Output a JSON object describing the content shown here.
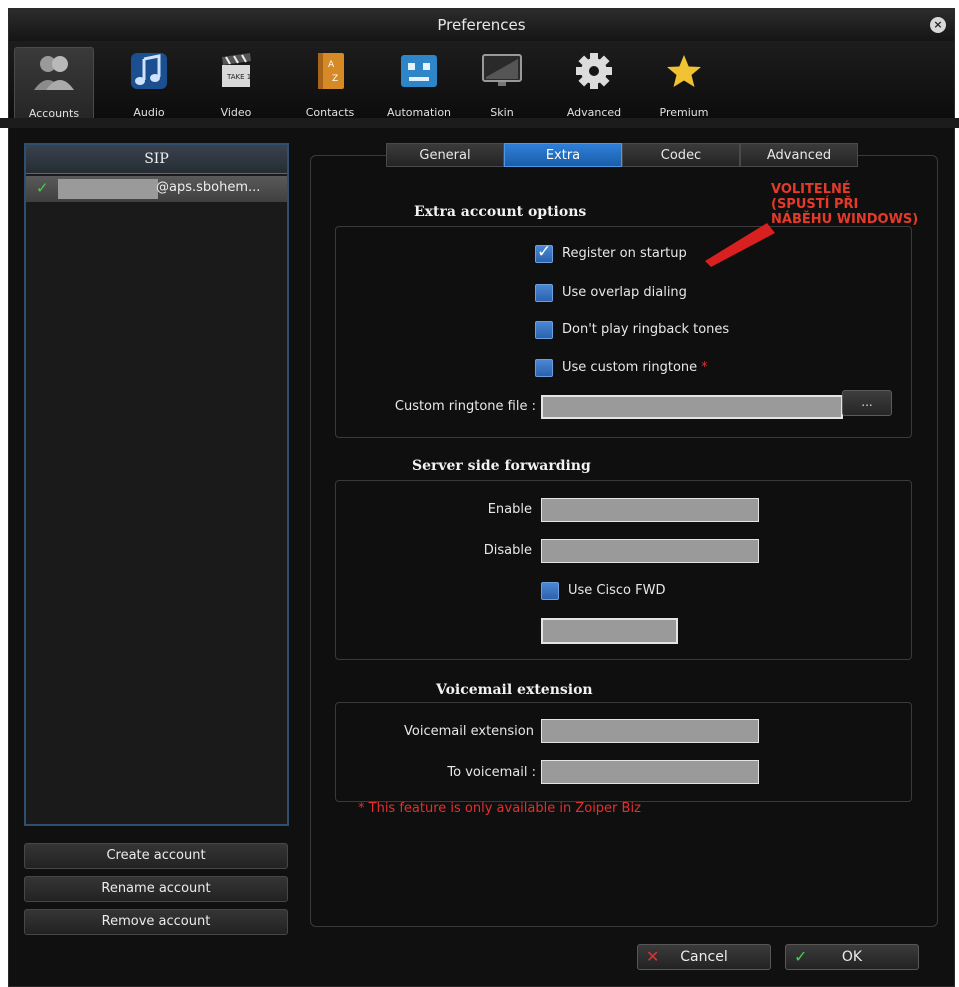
{
  "window": {
    "title": "Preferences"
  },
  "toolbar": {
    "items": [
      {
        "label": "Accounts",
        "icon": "accounts-icon"
      },
      {
        "label": "Audio",
        "icon": "music-note-icon"
      },
      {
        "label": "Video",
        "icon": "clapperboard-icon"
      },
      {
        "label": "Contacts",
        "icon": "address-book-icon"
      },
      {
        "label": "Automation",
        "icon": "robot-icon"
      },
      {
        "label": "Skin",
        "icon": "monitor-icon"
      },
      {
        "label": "Advanced",
        "icon": "gear-icon"
      },
      {
        "label": "Premium",
        "icon": "star-icon"
      }
    ]
  },
  "accounts": {
    "header": "SIP",
    "items": [
      {
        "name": "@aps.sbohem...",
        "status": "active"
      }
    ]
  },
  "left_buttons": {
    "create": "Create account",
    "rename": "Rename account",
    "remove": "Remove account"
  },
  "tabs": [
    {
      "label": "General",
      "active": false
    },
    {
      "label": "Extra",
      "active": true
    },
    {
      "label": "Codec",
      "active": false
    },
    {
      "label": "Advanced",
      "active": false
    }
  ],
  "extra": {
    "title": "Extra account options",
    "options": [
      {
        "label": "Register on startup",
        "checked": true,
        "star": ""
      },
      {
        "label": "Use overlap dialing",
        "checked": false,
        "star": ""
      },
      {
        "label": "Don't play ringback tones",
        "checked": false,
        "star": ""
      },
      {
        "label": "Use custom ringtone",
        "checked": false,
        "star": "*"
      }
    ],
    "ringtone_label": "Custom ringtone file :",
    "ringtone_value": "",
    "browse": "..."
  },
  "forwarding": {
    "title": "Server side forwarding",
    "enable_label": "Enable",
    "enable_value": "",
    "disable_label": "Disable",
    "disable_value": "",
    "cisco_label": "Use Cisco FWD",
    "cisco_checked": false,
    "cisco_value": ""
  },
  "voicemail": {
    "title": "Voicemail extension",
    "ext_label": "Voicemail extension",
    "ext_value": "",
    "to_label": "To voicemail :",
    "to_value": ""
  },
  "note": "* This feature is only available in Zoiper Biz",
  "annotation": {
    "line1": "VOLITELNÉ",
    "line2": "(SPUSTÍ PŘI",
    "line3": "NÁBĚHU WINDOWS)"
  },
  "footer": {
    "cancel": "Cancel",
    "ok": "OK"
  },
  "colors": {
    "accent": "#2b6fc2",
    "annotation": "#e53a2a",
    "ok": "#43d04a",
    "cancel": "#e23030"
  }
}
